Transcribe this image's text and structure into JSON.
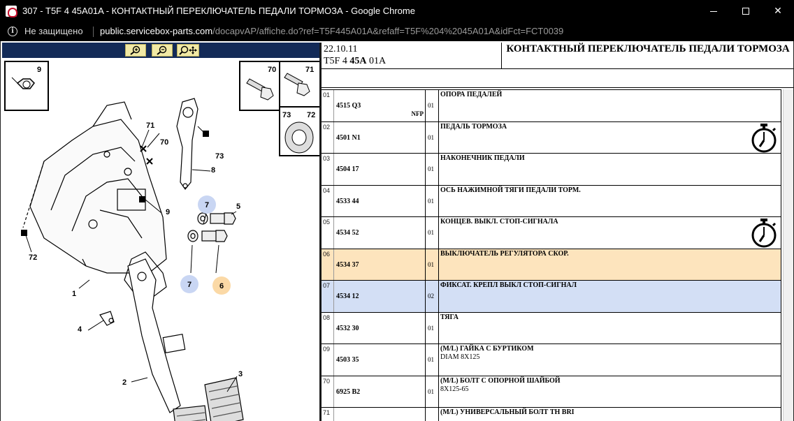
{
  "window": {
    "title": "307 - T5F 4 45A01A - КОНТАКТНЫЙ ПЕРЕКЛЮЧАТЕЛЬ ПЕДАЛИ ТОРМОЗА - Google Chrome",
    "minimize_label": "—",
    "maximize_label": "☐",
    "close_label": "✕"
  },
  "address_bar": {
    "security_label": "Не защищено",
    "url_host": "public.servicebox-parts.com",
    "url_path": "/docapvAP/affiche.do?ref=T5F445A01A&refaff=T5F%204%2045A01A&idFct=FCT0039"
  },
  "diagram": {
    "callouts": [
      "9",
      "70",
      "71",
      "73",
      "72",
      "71",
      "70",
      "73",
      "8",
      "9",
      "7",
      "5",
      "72",
      "7",
      "6",
      "1",
      "4",
      "2",
      "3"
    ]
  },
  "header": {
    "date": "22.10.11",
    "code_prefix": "T5F 4 ",
    "code_bold": "45A",
    "code_suffix": " 01A",
    "title": "КОНТАКТНЫЙ ПЕРЕКЛЮЧАТЕЛЬ ПЕДАЛИ ТОРМОЗА"
  },
  "rows": [
    {
      "idx": "01",
      "ref": "4515 Q3",
      "nfp": "NFP",
      "qty": "01",
      "desc": "ОПОРА ПЕДАЛЕЙ",
      "desc2": ""
    },
    {
      "idx": "02",
      "ref": "4501 N1",
      "nfp": "",
      "qty": "01",
      "desc": "ПЕДАЛЬ ТОРМОЗА",
      "desc2": "",
      "stopwatch": true
    },
    {
      "idx": "03",
      "ref": "4504 17",
      "nfp": "",
      "qty": "01",
      "desc": "НАКОНЕЧНИК ПЕДАЛИ",
      "desc2": ""
    },
    {
      "idx": "04",
      "ref": "4533 44",
      "nfp": "",
      "qty": "01",
      "desc": "ОСЬ НАЖИМНОЙ ТЯГИ ПЕДАЛИ ТОРМ.",
      "desc2": ""
    },
    {
      "idx": "05",
      "ref": "4534 52",
      "nfp": "",
      "qty": "01",
      "desc": "КОНЦЕВ. ВЫКЛ. СТОП-СИГНАЛА",
      "desc2": "",
      "stopwatch": true
    },
    {
      "idx": "06",
      "ref": "4534 37",
      "nfp": "",
      "qty": "01",
      "desc": "ВЫКЛЮЧАТЕЛЬ РЕГУЛЯТОРА СКОР.",
      "desc2": "",
      "highlight": "#fde4bd"
    },
    {
      "idx": "07",
      "ref": "4534 12",
      "nfp": "",
      "qty": "02",
      "desc": "ФИКСАТ. КРЕПЛ ВЫКЛ СТОП-СИГНАЛ",
      "desc2": "",
      "highlight": "#d3dff5"
    },
    {
      "idx": "08",
      "ref": "4532 30",
      "nfp": "",
      "qty": "01",
      "desc": "ТЯГА",
      "desc2": ""
    },
    {
      "idx": "09",
      "ref": "4503 35",
      "nfp": "",
      "qty": "01",
      "desc": "(M/L) ГАЙКА С БУРТИКОМ",
      "desc2": "DIAM 8X125"
    },
    {
      "idx": "70",
      "ref": "6925 B2",
      "nfp": "",
      "qty": "01",
      "desc": "(M/L) БОЛТ С ОПОРНОЙ ШАЙБОЙ",
      "desc2": "8X125-65"
    },
    {
      "idx": "71",
      "ref": "",
      "nfp": "",
      "qty": "",
      "desc": "(M/L) УНИВЕРСАЛЬНЫЙ БОЛТ TH BRI",
      "desc2": ""
    }
  ]
}
